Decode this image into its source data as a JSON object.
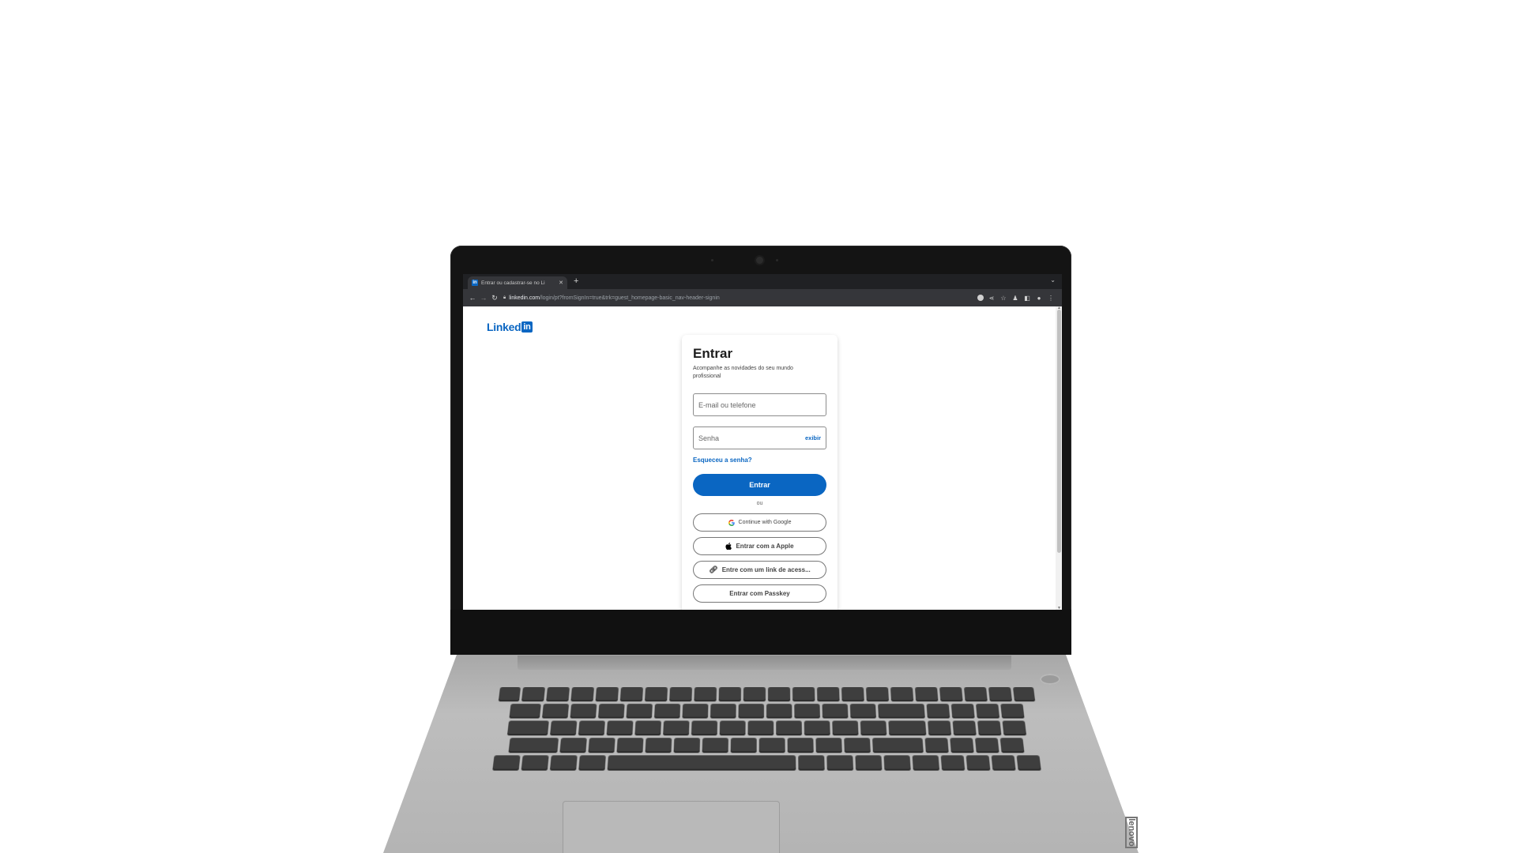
{
  "browser": {
    "tab_title": "Entrar ou cadastrar-se no Li",
    "tab_favicon": "in",
    "new_tab_label": "+",
    "url_host": "linkedin.com",
    "url_path": "/login/pt?fromSignIn=true&trk=guest_homepage-basic_nav-header-signin"
  },
  "page": {
    "logo_text": "Linked",
    "logo_in": "in",
    "title": "Entrar",
    "subtitle": "Acompanhe as novidades do seu mundo profissional",
    "email_placeholder": "E-mail ou telefone",
    "password_placeholder": "Senha",
    "show_password": "exibir",
    "forgot_password": "Esqueceu a senha?",
    "submit_label": "Entrar",
    "divider_text": "ou",
    "google_label": "Continue with Google",
    "apple_label": "Entrar com a Apple",
    "link_label": "Entre com um link de acess...",
    "passkey_label": "Entrar com Passkey"
  },
  "device": {
    "brand": "lenovo"
  },
  "colors": {
    "brand_blue": "#0a66c2",
    "chrome_dark": "#202124"
  }
}
